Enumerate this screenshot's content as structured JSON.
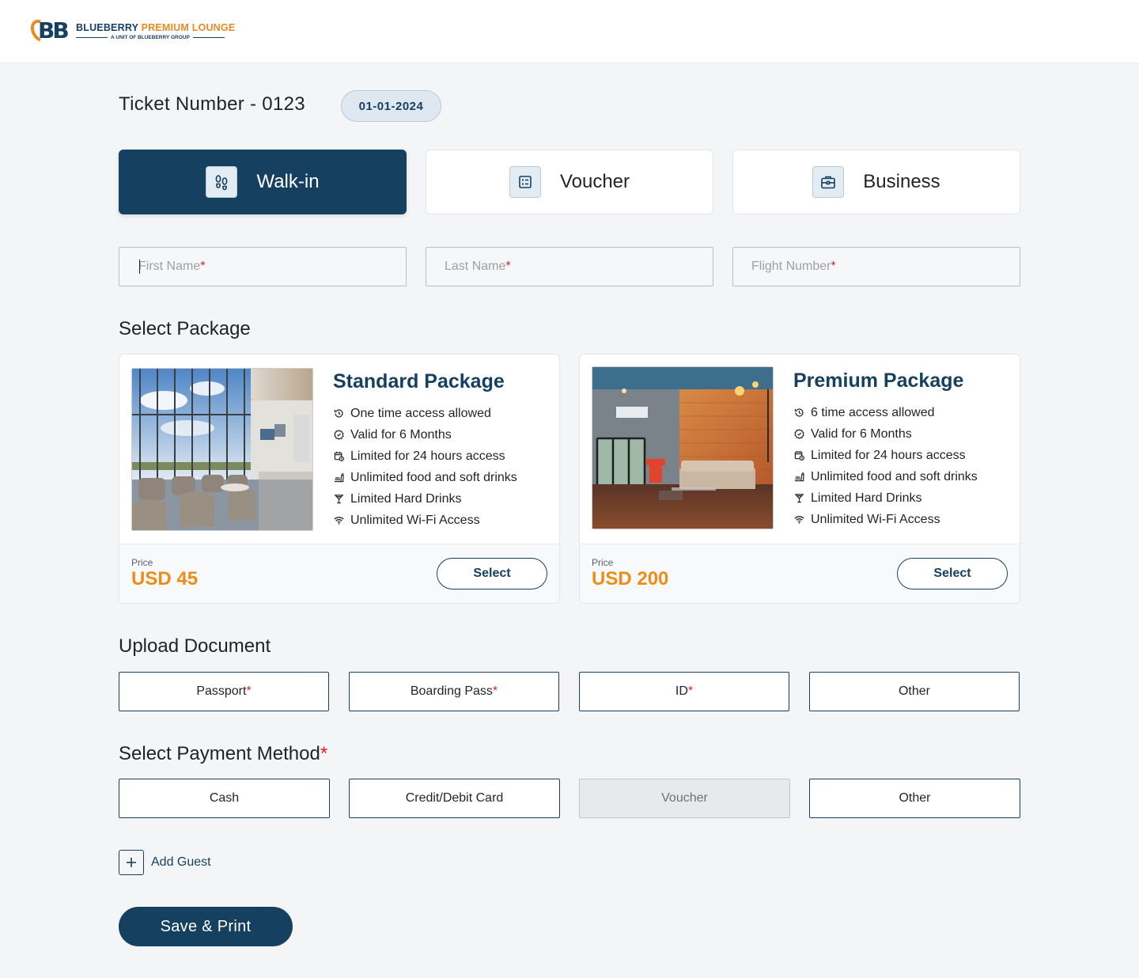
{
  "brand": {
    "mark": "BB",
    "name_primary": "BLUEBERRY",
    "name_accent": "PREMIUM LOUNGE",
    "tagline": "A UNIT OF BLUEBERRY GROUP"
  },
  "ticket": {
    "title": "Ticket Number - 0123",
    "date": "01-01-2024"
  },
  "visit_types": [
    {
      "label": "Walk-in",
      "icon": "footsteps-icon",
      "active": true
    },
    {
      "label": "Voucher",
      "icon": "voucher-list-icon",
      "active": false
    },
    {
      "label": "Business",
      "icon": "briefcase-icon",
      "active": false
    }
  ],
  "form": {
    "first_name": {
      "placeholder": "First Name",
      "value": ""
    },
    "last_name": {
      "placeholder": "Last Name",
      "value": ""
    },
    "flight_number": {
      "placeholder": "Flight Number",
      "value": ""
    },
    "required_mark": "*"
  },
  "packages_section": {
    "title": "Select Package",
    "price_label": "Price",
    "select_label": "Select",
    "packages": [
      {
        "name": "Standard Package",
        "price": "USD 45",
        "features": [
          {
            "icon": "history-icon",
            "text": "One time access allowed"
          },
          {
            "icon": "verified-badge-icon",
            "text": "Valid for 6 Months"
          },
          {
            "icon": "calendar-clock-icon",
            "text": "Limited for 24 hours access"
          },
          {
            "icon": "food-drink-icon",
            "text": "Unlimited food and soft drinks"
          },
          {
            "icon": "cocktail-icon",
            "text": "Limited Hard Drinks"
          },
          {
            "icon": "wifi-icon",
            "text": "Unlimited Wi-Fi Access"
          }
        ]
      },
      {
        "name": "Premium Package",
        "price": "USD 200",
        "features": [
          {
            "icon": "history-icon",
            "text": "6 time access allowed"
          },
          {
            "icon": "verified-badge-icon",
            "text": "Valid for 6 Months"
          },
          {
            "icon": "calendar-clock-icon",
            "text": "Limited for 24 hours access"
          },
          {
            "icon": "food-drink-icon",
            "text": "Unlimited food and soft drinks"
          },
          {
            "icon": "cocktail-icon",
            "text": "Limited Hard Drinks"
          },
          {
            "icon": "wifi-icon",
            "text": "Unlimited Wi-Fi Access"
          }
        ]
      }
    ]
  },
  "upload_section": {
    "title": "Upload Document",
    "documents": [
      {
        "label": "Passport",
        "required": true
      },
      {
        "label": "Boarding Pass",
        "required": true
      },
      {
        "label": "ID",
        "required": true
      },
      {
        "label": "Other",
        "required": false
      }
    ]
  },
  "payment_section": {
    "title": "Select Payment Method",
    "methods": [
      {
        "label": "Cash",
        "disabled": false
      },
      {
        "label": "Credit/Debit Card",
        "disabled": false
      },
      {
        "label": "Voucher",
        "disabled": true
      },
      {
        "label": "Other",
        "disabled": false
      }
    ]
  },
  "add_guest_label": "Add Guest",
  "save_print_label": "Save & Print",
  "colors": {
    "primary": "#16405f",
    "accent": "#ef8c18",
    "required": "#e02424",
    "background": "#f3f5f7"
  }
}
